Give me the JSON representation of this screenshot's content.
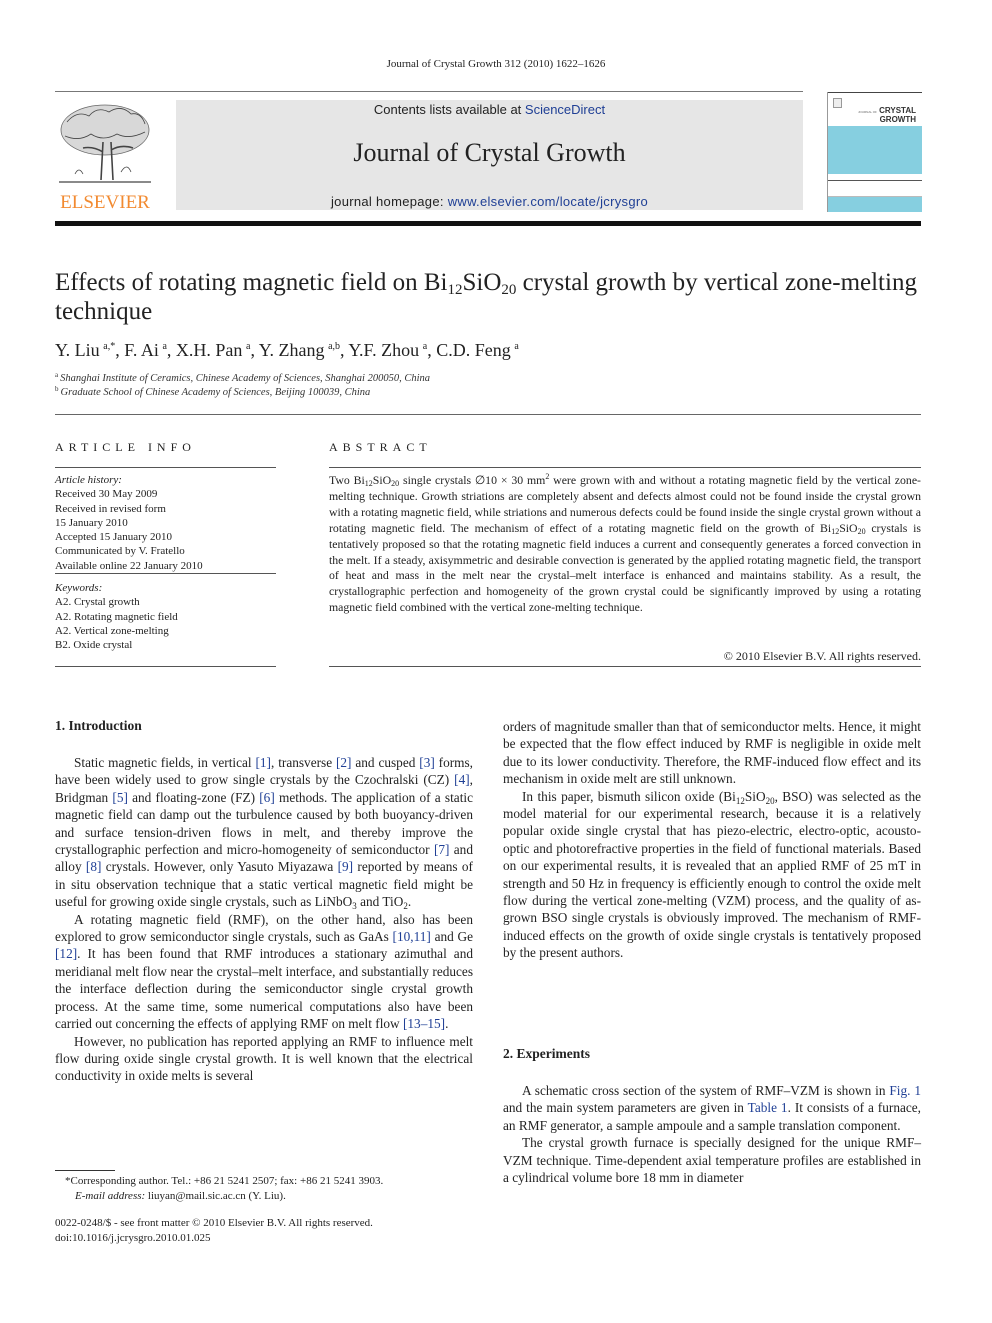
{
  "header": {
    "citation": "Journal of Crystal Growth 312 (2010) 1622–1626",
    "contents_prefix": "Contents lists available at ",
    "contents_link": "ScienceDirect",
    "journal_title": "Journal of Crystal Growth",
    "homepage_prefix": "journal homepage: ",
    "homepage_link": "www.elsevier.com/locate/jcrysgro",
    "publisher_logo": "ELSEVIER",
    "cover_title_line1": "CRYSTAL",
    "cover_title_line2": "GROWTH",
    "cover_small": "JOURNAL OF",
    "colors": {
      "publisher_orange": "#f28a30",
      "link_blue": "#1f3f95",
      "cover_blue": "#86cfe0",
      "banner_gray": "#e6e6e6"
    }
  },
  "article": {
    "title_part1": "Effects of rotating magnetic field on Bi",
    "title_sub1": "12",
    "title_part2": "SiO",
    "title_sub2": "20",
    "title_part3": " crystal growth by vertical zone-melting technique",
    "authors": [
      {
        "name": "Y. Liu",
        "sup": "a,*"
      },
      {
        "name": "F. Ai",
        "sup": "a"
      },
      {
        "name": "X.H. Pan",
        "sup": "a"
      },
      {
        "name": "Y. Zhang",
        "sup": "a,b"
      },
      {
        "name": "Y.F. Zhou",
        "sup": "a"
      },
      {
        "name": "C.D. Feng",
        "sup": "a"
      }
    ],
    "affiliations": [
      {
        "mark": "a",
        "text": "Shanghai Institute of Ceramics, Chinese Academy of Sciences, Shanghai 200050, China"
      },
      {
        "mark": "b",
        "text": "Graduate School of Chinese Academy of Sciences, Beijing 100039, China"
      }
    ]
  },
  "article_info": {
    "heading": "ARTICLE INFO",
    "history_label": "Article history:",
    "history": [
      "Received 30 May 2009",
      "Received in revised form",
      "15 January 2010",
      "Accepted 15 January 2010",
      "Communicated by V. Fratello",
      "Available online 22 January 2010"
    ],
    "keywords_label": "Keywords:",
    "keywords": [
      "A2. Crystal growth",
      "A2. Rotating magnetic field",
      "A2. Vertical zone-melting",
      "B2. Oxide crystal"
    ]
  },
  "abstract": {
    "heading": "ABSTRACT",
    "s1a": "Two Bi",
    "s1b": "12",
    "s1c": "SiO",
    "s1d": "20",
    "s1e": " single crystals ∅10 × 30 mm",
    "s1f": "2",
    "s1g": " were grown with and without a rotating magnetic field by the vertical zone-melting technique. Growth striations are completely absent and defects almost could not be found inside the crystal grown with a rotating magnetic field, while striations and numerous defects could be found inside the single crystal grown without a rotating magnetic field. The mechanism of effect of a rotating magnetic field on the growth of Bi",
    "s1h": "12",
    "s1i": "SiO",
    "s1j": "20",
    "s1k": " crystals is tentatively proposed so that the rotating magnetic field induces a current and consequently generates a forced convection in the melt. If a steady, axisymmetric and desirable convection is generated by the applied rotating magnetic field, the transport of heat and mass in the melt near the crystal–melt interface is enhanced and maintains stability. As a result, the crystallographic perfection and homogeneity of the grown crystal could be significantly improved by using a rotating magnetic field combined with the vertical zone-melting technique.",
    "copyright": "© 2010 Elsevier B.V. All rights reserved."
  },
  "intro": {
    "heading": "1.  Introduction",
    "p1": [
      {
        "t": "Static magnetic fields, in vertical "
      },
      {
        "r": "[1]"
      },
      {
        "t": ", transverse "
      },
      {
        "r": "[2]"
      },
      {
        "t": " and cusped "
      },
      {
        "r": "[3]"
      },
      {
        "t": " forms, have been widely used to grow single crystals by the Czochralski (CZ) "
      },
      {
        "r": "[4]"
      },
      {
        "t": ", Bridgman "
      },
      {
        "r": "[5]"
      },
      {
        "t": " and floating-zone (FZ) "
      },
      {
        "r": "[6]"
      },
      {
        "t": " methods. The application of a static magnetic field can damp out the turbulence caused by both buoyancy-driven and surface tension-driven flows in melt, and thereby improve the crystallographic perfection and micro-homogeneity of semiconductor "
      },
      {
        "r": "[7]"
      },
      {
        "t": " and alloy "
      },
      {
        "r": "[8]"
      },
      {
        "t": " crystals. However, only Yasuto Miyazawa "
      },
      {
        "r": "[9]"
      },
      {
        "t": " reported by means of in situ observation technique that a static vertical magnetic field might be useful for growing oxide single crystals, such as LiNbO"
      },
      {
        "s": "3"
      },
      {
        "t": " and TiO"
      },
      {
        "s": "2"
      },
      {
        "t": "."
      }
    ],
    "p2": [
      {
        "t": "A rotating magnetic field (RMF), on the other hand, also has been explored to grow semiconductor single crystals, such as GaAs "
      },
      {
        "r": "[10,11]"
      },
      {
        "t": " and Ge "
      },
      {
        "r": "[12]"
      },
      {
        "t": ". It has been found that RMF introduces a stationary azimuthal and meridianal melt flow near the crystal–melt interface, and substantially reduces the interface deflection during the semiconductor single crystal growth process. At the same time, some numerical computations also have been carried out concerning the effects of applying RMF on melt flow "
      },
      {
        "r": "[13–15]"
      },
      {
        "t": "."
      }
    ],
    "p3": [
      {
        "t": "However, no publication has reported applying an RMF to influence melt flow during oxide single crystal growth. It is well known that the electrical conductivity in oxide melts is several"
      }
    ],
    "p3_cont": [
      {
        "t": "orders of magnitude smaller than that of semiconductor melts. Hence, it might be expected that the flow effect induced by RMF is negligible in oxide melt due to its lower conductivity. Therefore, the RMF-induced flow effect and its mechanism in oxide melt are still unknown."
      }
    ],
    "p4": [
      {
        "t": "In this paper, bismuth silicon oxide (Bi"
      },
      {
        "s": "12"
      },
      {
        "t": "SiO"
      },
      {
        "s": "20"
      },
      {
        "t": ", BSO) was selected as the model material for our experimental research, because it is a relatively popular oxide single crystal that has piezo-electric, electro-optic, acousto-optic and photorefractive properties in the field of functional materials. Based on our experimental results, it is revealed that an applied RMF of 25 mT in strength and 50 Hz in frequency is efficiently enough to control the oxide melt flow during the vertical zone-melting (VZM) process, and the quality of as-grown BSO single crystals is obviously improved. The mechanism of RMF-induced effects on the growth of oxide single crystals is tentatively proposed by the present authors."
      }
    ]
  },
  "experiments": {
    "heading": "2.  Experiments",
    "p1": [
      {
        "t": "A schematic cross section of the system of RMF–VZM is shown in "
      },
      {
        "r": "Fig. 1"
      },
      {
        "t": " and the main system parameters are given in "
      },
      {
        "r": "Table 1"
      },
      {
        "t": ". It consists of a furnace, an RMF generator, a sample ampoule and a sample translation component."
      }
    ],
    "p2": [
      {
        "t": "The crystal growth furnace is specially designed for the unique RMF–VZM technique. Time-dependent axial temperature profiles are established in a cylindrical volume bore 18 mm in diameter"
      }
    ]
  },
  "footnote": {
    "line1": "Corresponding author. Tel.: +86 21 5241 2507; fax: +86 21 5241 3903.",
    "email_label": "E-mail address:",
    "email": " liuyan@mail.sic.ac.cn (Y. Liu).",
    "issn": "0022-0248/$ - see front matter © 2010 Elsevier B.V. All rights reserved.",
    "doi": "doi:10.1016/j.jcrysgro.2010.01.025"
  }
}
